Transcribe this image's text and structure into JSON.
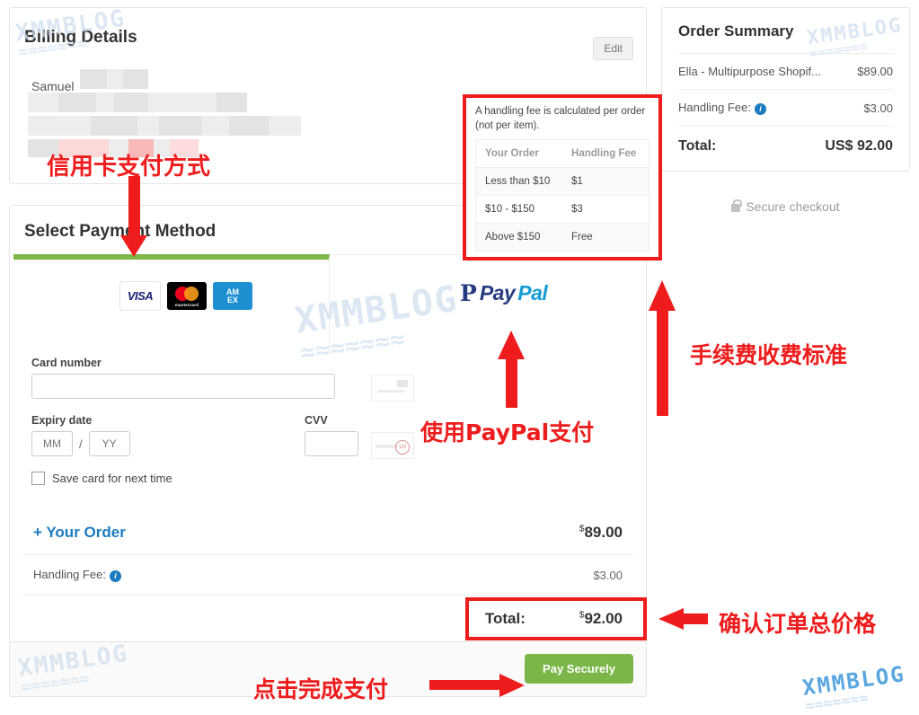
{
  "billing": {
    "title": "Billing Details",
    "edit_label": "Edit",
    "customer_name": "Samuel"
  },
  "payment": {
    "title": "Select Payment Method",
    "tabs": [
      {
        "id": "card",
        "label": "Credit Card",
        "selected": true,
        "logos": [
          "visa-logo",
          "mastercard-logo",
          "amex-logo"
        ],
        "visa_text": "VISA",
        "mc_text": "mastercard",
        "amex_line1": "AM",
        "amex_line2": "EX"
      },
      {
        "id": "paypal",
        "label": "PayPal",
        "selected": false,
        "pp_mark": "P",
        "pp_pay": "Pay",
        "pp_pal": "Pal"
      }
    ],
    "card_number_label": "Card number",
    "card_number_value": "",
    "expiry_label": "Expiry date",
    "expiry_month_placeholder": "MM",
    "expiry_year_placeholder": "YY",
    "expiry_separator": "/",
    "cvv_label": "CVV",
    "cvv_value": "",
    "save_card_label": "Save card for next time",
    "save_card_checked": false
  },
  "totals": {
    "your_order_label": "+ Your Order",
    "your_order_currency": "$",
    "your_order_amount": "89.00",
    "handling_label": "Handling Fee:",
    "handling_amount": "$3.00",
    "info_icon_glyph": "i",
    "total_label": "Total:",
    "total_currency": "$",
    "total_amount": "92.00"
  },
  "footer": {
    "pay_button_label": "Pay Securely"
  },
  "summary": {
    "title": "Order Summary",
    "rows": [
      {
        "label": "Ella - Multipurpose Shopif...",
        "amount": "$89.00"
      },
      {
        "label": "Handling Fee:",
        "amount": "$3.00",
        "has_info_icon": true
      }
    ],
    "total_label": "Total:",
    "total_amount": "US$ 92.00",
    "secure_checkout_label": "Secure checkout"
  },
  "fee_tooltip": {
    "description": "A handling fee is calculated per order (not per item).",
    "columns": [
      "Your Order",
      "Handling Fee"
    ],
    "rows": [
      [
        "Less than $10",
        "$1"
      ],
      [
        "$10 - $150",
        "$3"
      ],
      [
        "Above $150",
        "Free"
      ]
    ]
  },
  "annotations": {
    "credit_card": "信用卡支付方式",
    "paypal": "使用PayPal支付",
    "handling_fee": "手续费收费标准",
    "confirm_total": "确认订单总价格",
    "click_pay": "点击完成支付"
  },
  "watermark": {
    "text": "XMMBLOG",
    "waves": "≈≈≈≈≈≈≈"
  },
  "colors": {
    "accent_green": "#7ab648",
    "link_blue": "#1b7bbf",
    "annotation_red": "#ee1c1c",
    "info_blue": "#1b7bbf"
  }
}
